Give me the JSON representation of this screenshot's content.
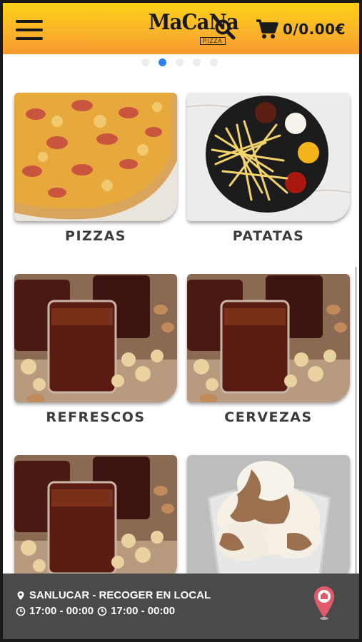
{
  "header": {
    "menu_icon": "hamburger-icon",
    "logo_text": "MaCaNa",
    "logo_sub": "PIZZA",
    "search_icon": "search-icon",
    "cart_icon": "cart-icon",
    "cart_summary": "0/0.00€",
    "background_colors": [
      "#fdd016",
      "#f79a2e"
    ]
  },
  "carousel": {
    "dots": 5,
    "active_index": 1,
    "active_color": "#2f80ed"
  },
  "categories": [
    {
      "label": "PIZZAS"
    },
    {
      "label": "PATATAS"
    },
    {
      "label": "REFRESCOS"
    },
    {
      "label": "CERVEZAS"
    },
    {
      "label": ""
    },
    {
      "label": ""
    }
  ],
  "footer": {
    "location_icon": "map-pin-icon",
    "location": "SANLUCAR - RECOGER EN LOCAL",
    "clock_icon": "clock-icon",
    "hours_1": "17:00 - 00:00",
    "hours_2": "17:00 - 00:00",
    "store_pin_icon": "store-location-pin-icon",
    "background": "#4a4a4a",
    "pin_color": "#e05a6a"
  }
}
